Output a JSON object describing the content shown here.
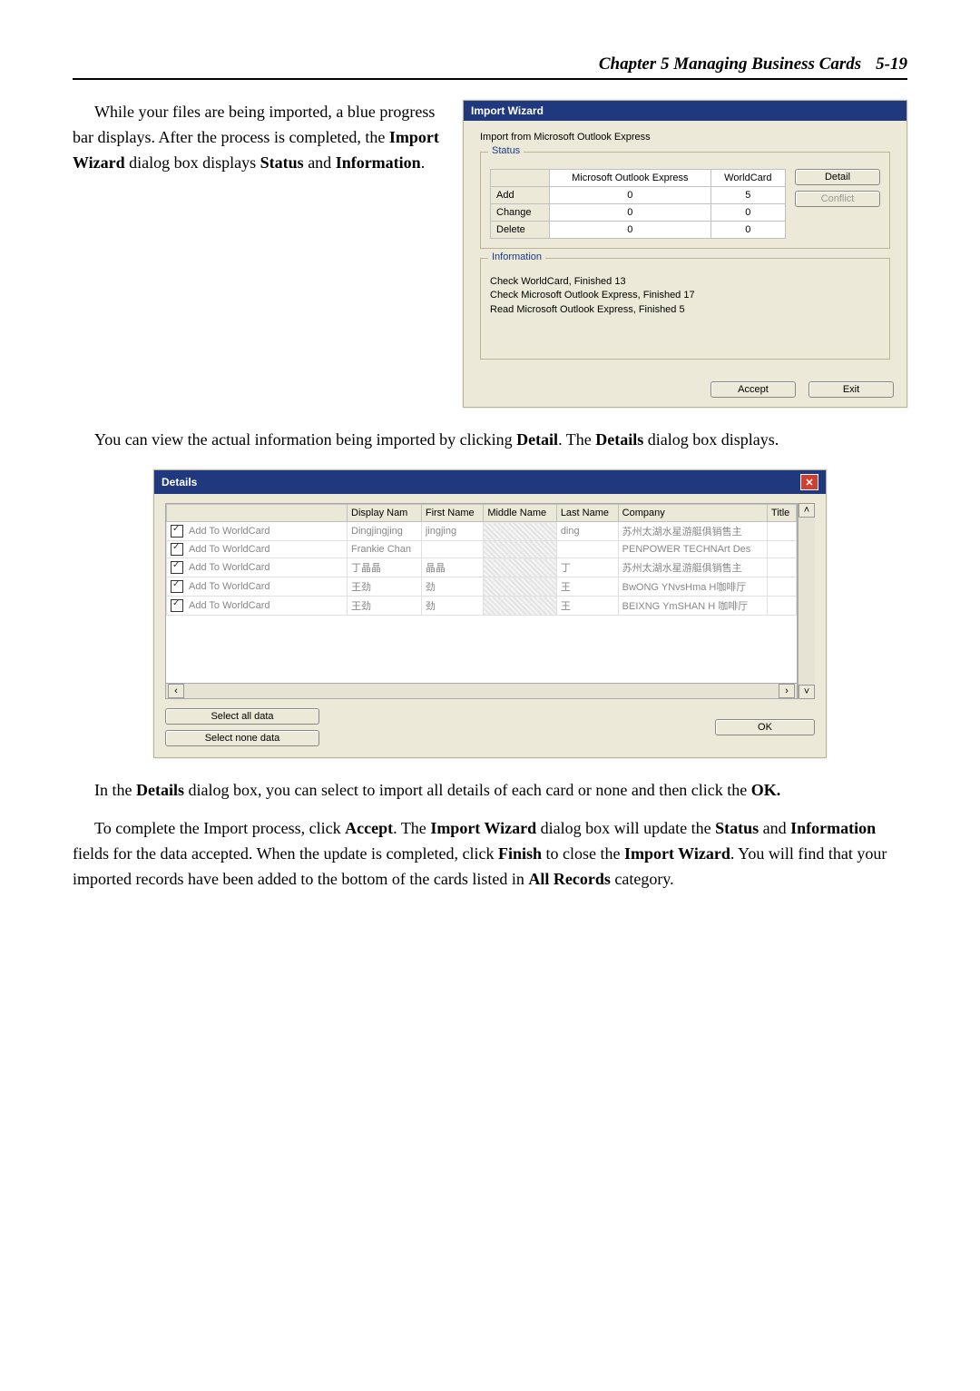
{
  "header": {
    "chapter": "Chapter 5 Managing Business Cards",
    "page": "5-19"
  },
  "para1_a": "While your files are being imported, a blue progress bar displays. After the process is completed, the ",
  "para1_b": "Import Wizard",
  "para1_c": " dialog box displays ",
  "para1_d": "Status",
  "para1_e": " and ",
  "para1_f": "Information",
  "para1_g": ".",
  "wizard": {
    "title": "Import Wizard",
    "subtitle": "Import from Microsoft Outlook Express",
    "status_label": "Status",
    "status_cols": [
      "",
      "Microsoft Outlook Express",
      "WorldCard"
    ],
    "status_rows": [
      {
        "label": "Add",
        "a": "0",
        "b": "5"
      },
      {
        "label": "Change",
        "a": "0",
        "b": "0"
      },
      {
        "label": "Delete",
        "a": "0",
        "b": "0"
      }
    ],
    "detail_btn": "Detail",
    "conflict_btn": "Conflict",
    "info_label": "Information",
    "info_lines": [
      "Check WorldCard, Finished 13",
      "Check Microsoft Outlook Express, Finished 17",
      "Read Microsoft Outlook Express, Finished 5"
    ],
    "accept_btn": "Accept",
    "exit_btn": "Exit"
  },
  "para2_a": "You can view the actual information being imported by clicking ",
  "para2_b": "Detail",
  "para2_c": ". The ",
  "para2_d": "Details",
  "para2_e": " dialog box displays.",
  "details": {
    "title": "Details",
    "cols": [
      "",
      "Display Nam",
      "First Name",
      "Middle Name",
      "Last Name",
      "Company",
      "Title"
    ],
    "rows": [
      {
        "chk_label": "Add To WorldCard",
        "display": "Dingjingjing",
        "first": "jingjing",
        "middle": "",
        "last": "ding",
        "company": "苏州太湖水星游艇俱销售主",
        "title": ""
      },
      {
        "chk_label": "Add To WorldCard",
        "display": "Frankie Chan",
        "first": "",
        "middle": "",
        "last": "",
        "company": "PENPOWER TECHNArt Des",
        "title": ""
      },
      {
        "chk_label": "Add To WorldCard",
        "display": "丁晶晶",
        "first": "晶晶",
        "middle": "",
        "last": "丁",
        "company": "苏州太湖水星游艇俱销售主",
        "title": ""
      },
      {
        "chk_label": "Add To WorldCard",
        "display": "王劲",
        "first": "劲",
        "middle": "",
        "last": "王",
        "company": "BwONG YNvsHma H咖啡厅",
        "title": ""
      },
      {
        "chk_label": "Add To WorldCard",
        "display": "王劲",
        "first": "劲",
        "middle": "",
        "last": "王",
        "company": "BEIXNG YmSHAN H 咖啡厅",
        "title": ""
      }
    ],
    "select_all": "Select all data",
    "select_none": "Select none data",
    "ok": "OK"
  },
  "para3_a": "In the ",
  "para3_b": "Details",
  "para3_c": " dialog box, you can select to import all details of each card or none and then click the ",
  "para3_d": "OK.",
  "para4_a": "To complete the Import process, click ",
  "para4_b": "Accept",
  "para4_c": ". The ",
  "para4_d": "Import Wizard",
  "para4_e": " dialog box will update the ",
  "para4_f": "Status",
  "para4_g": " and ",
  "para4_h": "Information",
  "para4_i": " fields for the data accepted. When the update is completed, click ",
  "para4_j": "Finish",
  "para4_k": " to close the ",
  "para4_l": "Import Wizard",
  "para4_m": ". You will find that your imported records have been added to the bottom of the cards listed in ",
  "para4_n": "All Records",
  "para4_o": " category."
}
